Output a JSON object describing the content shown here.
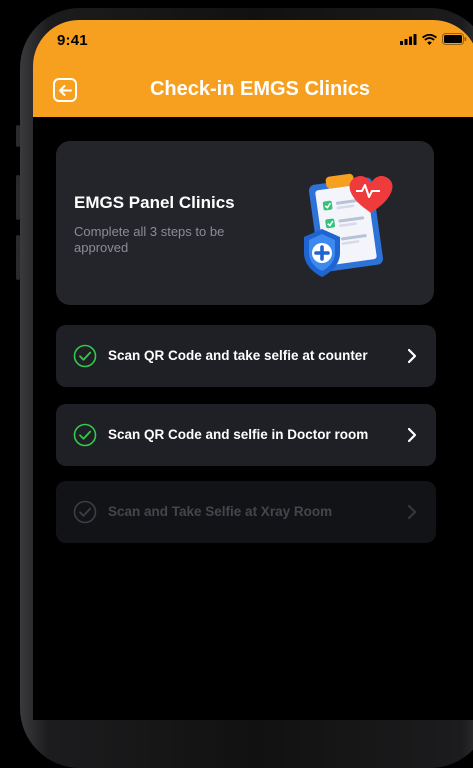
{
  "status_bar": {
    "time": "9:41"
  },
  "header": {
    "title": "Check-in EMGS Clinics"
  },
  "card": {
    "title": "EMGS Panel Clinics",
    "subtitle": "Complete all 3 steps to be approved"
  },
  "steps": [
    {
      "label": "Scan QR Code and take selfie at counter",
      "completed": true,
      "enabled": true
    },
    {
      "label": "Scan QR Code and selfie in Doctor room",
      "completed": true,
      "enabled": true
    },
    {
      "label": "Scan and Take Selfie at Xray Room",
      "completed": false,
      "enabled": false
    }
  ],
  "colors": {
    "accent": "#f7a01f",
    "background": "#000000",
    "card": "#24252b",
    "step": "#1f2026",
    "check_green": "#33c94a"
  }
}
